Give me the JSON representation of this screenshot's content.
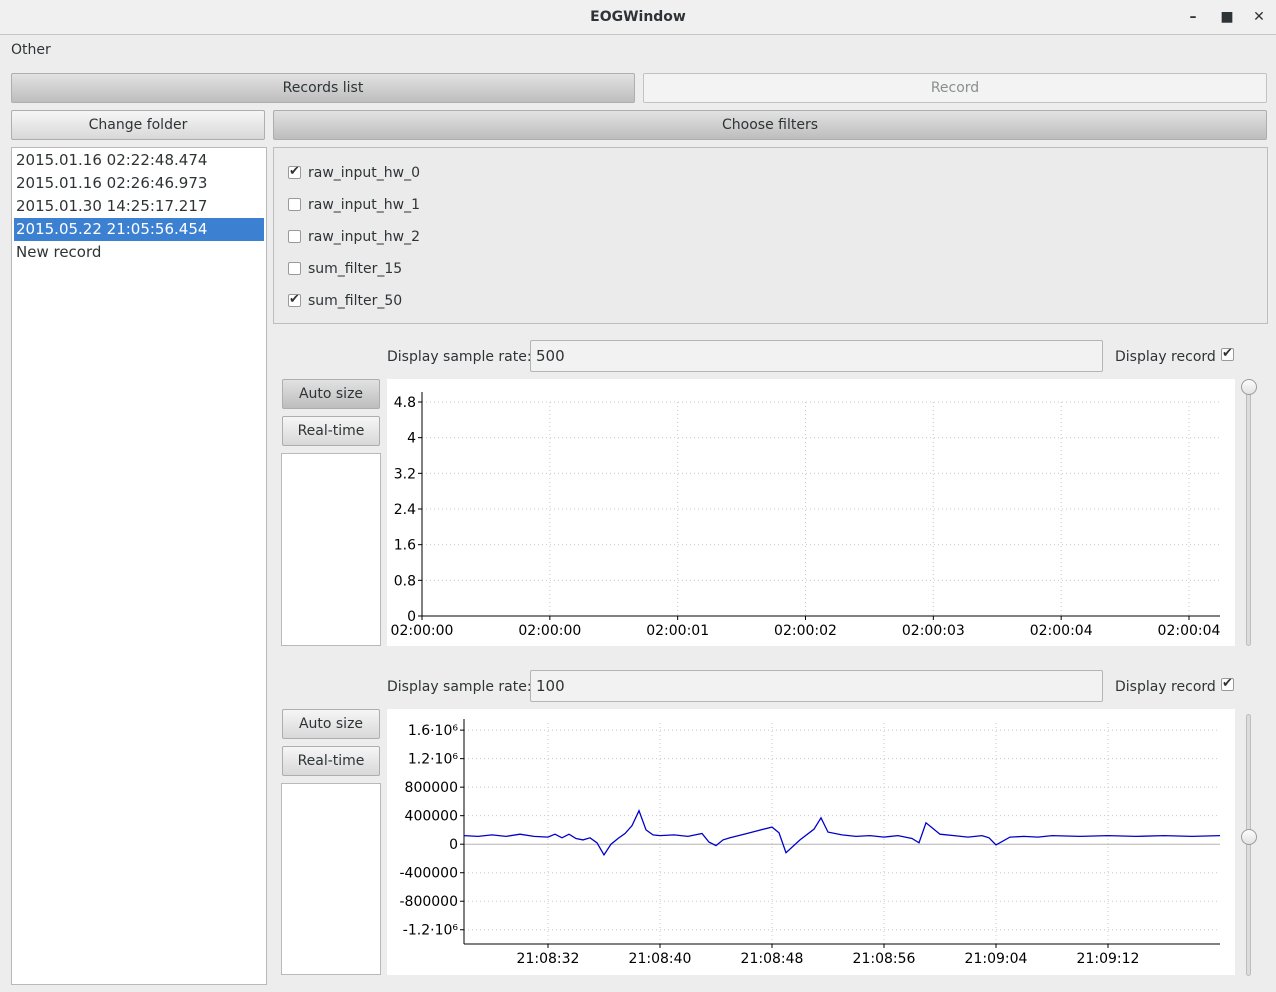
{
  "window": {
    "title": "EOGWindow",
    "min_icon": "minimize-icon",
    "max_icon": "maximize-icon",
    "close_icon": "close-icon"
  },
  "menu": {
    "other": "Other"
  },
  "tabs": {
    "records_list": "Records list",
    "record": "Record"
  },
  "sidebar": {
    "change_folder": "Change folder",
    "items": [
      {
        "label": "2015.01.16 02:22:48.474",
        "selected": false
      },
      {
        "label": "2015.01.16 02:26:46.973",
        "selected": false
      },
      {
        "label": "2015.01.30 14:25:17.217",
        "selected": false
      },
      {
        "label": "2015.05.22 21:05:56.454",
        "selected": true
      },
      {
        "label": "New record",
        "selected": false
      }
    ]
  },
  "filters": {
    "button": "Choose filters",
    "items": [
      {
        "label": "raw_input_hw_0",
        "checked": true
      },
      {
        "label": "raw_input_hw_1",
        "checked": false
      },
      {
        "label": "raw_input_hw_2",
        "checked": false
      },
      {
        "label": "sum_filter_15",
        "checked": false
      },
      {
        "label": "sum_filter_50",
        "checked": true
      }
    ]
  },
  "plot1": {
    "sample_rate_label": "Display sample rate:",
    "sample_rate_value": "500",
    "display_record_label": "Display record",
    "display_record_checked": true,
    "auto_size": "Auto size",
    "real_time": "Real-time"
  },
  "plot2": {
    "sample_rate_label": "Display sample rate:",
    "sample_rate_value": "100",
    "display_record_label": "Display record",
    "display_record_checked": true,
    "auto_size": "Auto size",
    "real_time": "Real-time"
  },
  "chart_data": [
    {
      "type": "line",
      "ylim": [
        0,
        4.8
      ],
      "yticks": [
        "0",
        "0.8",
        "1.6",
        "2.4",
        "3.2",
        "4",
        "4.8"
      ],
      "ytick_values": [
        0,
        0.8,
        1.6,
        2.4,
        3.2,
        4,
        4.8
      ],
      "xticks": [
        "02:00:00",
        "02:00:00",
        "02:00:01",
        "02:00:02",
        "02:00:03",
        "02:00:04",
        "02:00:04"
      ],
      "grid": true,
      "series": []
    },
    {
      "type": "line",
      "ylim": [
        -1400000,
        1700000
      ],
      "yticks": [
        "1.6·10⁶",
        "1.2·10⁶",
        "800000",
        "400000",
        "0",
        "-400000",
        "-800000",
        "-1.2·10⁶"
      ],
      "ytick_values": [
        1600000,
        1200000,
        800000,
        400000,
        0,
        -400000,
        -800000,
        -1200000
      ],
      "xticks": [
        "21:08:32",
        "21:08:40",
        "21:08:48",
        "21:08:56",
        "21:09:04",
        "21:09:12"
      ],
      "xtick_values": [
        32,
        40,
        48,
        56,
        64,
        72
      ],
      "xlim": [
        26,
        80
      ],
      "grid": true,
      "color": "#0000cc",
      "series": [
        {
          "x": [
            26,
            27,
            28,
            29,
            30,
            31,
            32,
            32.5,
            33,
            33.5,
            34,
            34.5,
            35,
            35.5,
            36,
            36.5,
            37,
            37.5,
            38,
            38.5,
            39,
            39.5,
            40,
            41,
            42,
            43,
            43.5,
            44,
            44.5,
            45,
            46,
            47,
            48,
            48.5,
            49,
            50,
            51,
            51.5,
            52,
            53,
            54,
            55,
            56,
            57,
            58,
            58.5,
            59,
            60,
            61,
            62,
            63,
            63.5,
            64,
            65,
            66,
            67,
            68,
            70,
            72,
            74,
            76,
            78,
            80
          ],
          "y": [
            120000,
            110000,
            130000,
            110000,
            140000,
            110000,
            100000,
            140000,
            90000,
            140000,
            80000,
            60000,
            90000,
            20000,
            -150000,
            0,
            80000,
            150000,
            260000,
            470000,
            200000,
            130000,
            120000,
            130000,
            110000,
            150000,
            30000,
            -20000,
            60000,
            90000,
            140000,
            190000,
            240000,
            160000,
            -120000,
            60000,
            210000,
            370000,
            170000,
            130000,
            110000,
            120000,
            100000,
            120000,
            80000,
            20000,
            300000,
            140000,
            120000,
            100000,
            120000,
            90000,
            -10000,
            100000,
            110000,
            100000,
            120000,
            110000,
            120000,
            110000,
            120000,
            110000,
            120000
          ]
        }
      ]
    }
  ]
}
